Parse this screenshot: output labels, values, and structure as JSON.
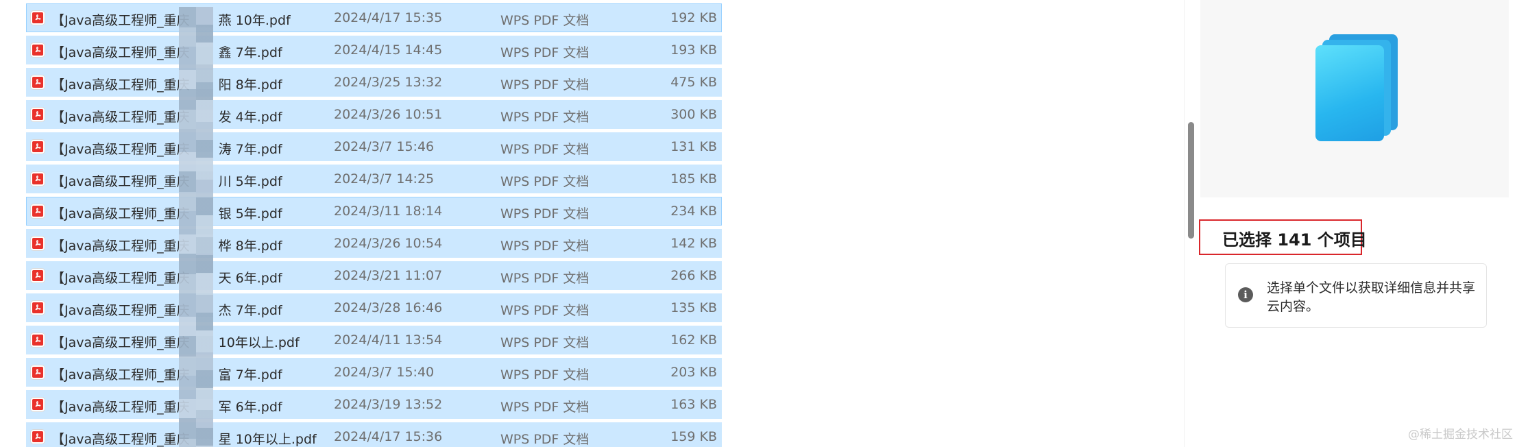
{
  "files": [
    {
      "name_a": "【Java高级工程师_重庆",
      "name_b": "燕 10年.pdf",
      "date": "2024/4/17 15:35",
      "type": "WPS PDF 文档",
      "size": "192 KB"
    },
    {
      "name_a": "【Java高级工程师_重庆",
      "name_b": "鑫 7年.pdf",
      "date": "2024/4/15 14:45",
      "type": "WPS PDF 文档",
      "size": "193 KB"
    },
    {
      "name_a": "【Java高级工程师_重庆",
      "name_b": "阳 8年.pdf",
      "date": "2024/3/25 13:32",
      "type": "WPS PDF 文档",
      "size": "475 KB"
    },
    {
      "name_a": "【Java高级工程师_重庆",
      "name_b": "发 4年.pdf",
      "date": "2024/3/26 10:51",
      "type": "WPS PDF 文档",
      "size": "300 KB"
    },
    {
      "name_a": "【Java高级工程师_重庆",
      "name_b": "涛 7年.pdf",
      "date": "2024/3/7 15:46",
      "type": "WPS PDF 文档",
      "size": "131 KB"
    },
    {
      "name_a": "【Java高级工程师_重庆",
      "name_b": "川 5年.pdf",
      "date": "2024/3/7 14:25",
      "type": "WPS PDF 文档",
      "size": "185 KB"
    },
    {
      "name_a": "【Java高级工程师_重庆",
      "name_b": "银 5年.pdf",
      "date": "2024/3/11 18:14",
      "type": "WPS PDF 文档",
      "size": "234 KB"
    },
    {
      "name_a": "【Java高级工程师_重庆",
      "name_b": "桦 8年.pdf",
      "date": "2024/3/26 10:54",
      "type": "WPS PDF 文档",
      "size": "142 KB"
    },
    {
      "name_a": "【Java高级工程师_重庆",
      "name_b": "天 6年.pdf",
      "date": "2024/3/21 11:07",
      "type": "WPS PDF 文档",
      "size": "266 KB"
    },
    {
      "name_a": "【Java高级工程师_重庆",
      "name_b": "杰 7年.pdf",
      "date": "2024/3/28 16:46",
      "type": "WPS PDF 文档",
      "size": "135 KB"
    },
    {
      "name_a": "【Java高级工程师_重庆",
      "name_b": "10年以上.pdf",
      "date": "2024/4/11 13:54",
      "type": "WPS PDF 文档",
      "size": "162 KB"
    },
    {
      "name_a": "【Java高级工程师_重庆",
      "name_b": "富 7年.pdf",
      "date": "2024/3/7 15:40",
      "type": "WPS PDF 文档",
      "size": "203 KB"
    },
    {
      "name_a": "【Java高级工程师_重庆",
      "name_b": "军 6年.pdf",
      "date": "2024/3/19 13:52",
      "type": "WPS PDF 文档",
      "size": "163 KB"
    },
    {
      "name_a": "【Java高级工程师_重庆",
      "name_b": "星 10年以上.pdf",
      "date": "2024/4/17 15:36",
      "type": "WPS PDF 文档",
      "size": "159 KB"
    }
  ],
  "details": {
    "selected_title": "已选择 141 个项目",
    "info_text": "选择单个文件以获取详细信息并共享云内容。"
  },
  "watermark": "@稀土掘金技术社区",
  "colors": {
    "row_selected": "#cce8ff",
    "highlight_border": "#d9262b",
    "pdf_icon": "#e9312a"
  }
}
